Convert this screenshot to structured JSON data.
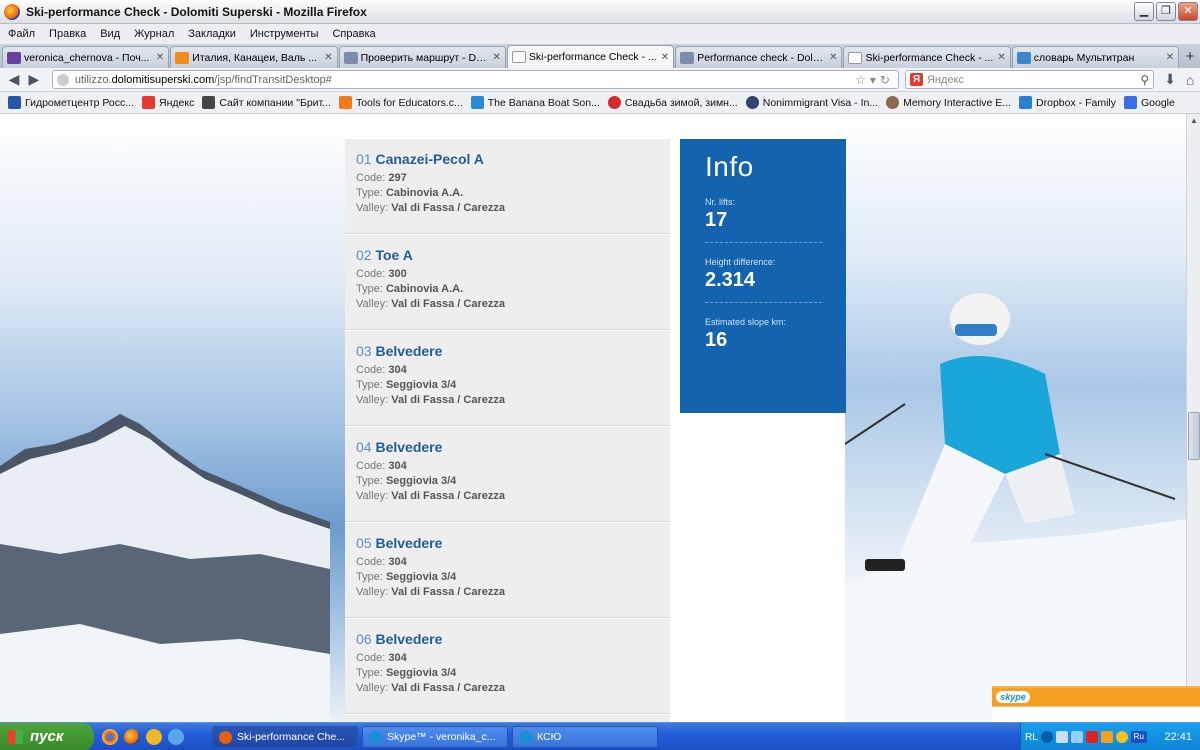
{
  "window": {
    "title": "Ski-performance Check - Dolomiti Superski - Mozilla Firefox"
  },
  "menu": [
    "Файл",
    "Правка",
    "Вид",
    "Журнал",
    "Закладки",
    "Инструменты",
    "Справка"
  ],
  "tabs": [
    {
      "label": "veronica_chernova - Поч...",
      "color": "#6b3fa0",
      "active": false
    },
    {
      "label": "Италия, Канацеи, Валь ...",
      "color": "#f08a1c",
      "active": false
    },
    {
      "label": "Проверить маршрут - Do...",
      "color": "#7a8ca8",
      "active": false
    },
    {
      "label": "Ski-performance Check - ...",
      "color": "#ffffff",
      "active": true
    },
    {
      "label": "Performance check - Dolo...",
      "color": "#7a8ca8",
      "active": false
    },
    {
      "label": "Ski-performance Check - ...",
      "color": "#ffffff",
      "active": false
    },
    {
      "label": "словарь Мультитран",
      "color": "#3a86c8",
      "active": false
    }
  ],
  "nav": {
    "url_prefix": "utilizzo.",
    "url_domain": "dolomitisuperski.com",
    "url_path": "/jsp/findTransitDesktop#",
    "search_placeholder": "Яндекс",
    "search_engine_glyph": "Я"
  },
  "bookmarks": [
    {
      "label": "Гидрометцентр Росс...",
      "color": "#2557a8"
    },
    {
      "label": "Яндекс",
      "color": "#e7382a"
    },
    {
      "label": "Сайт компании \"Брит...",
      "color": "#444444"
    },
    {
      "label": "Tools for Educators.c...",
      "color": "#f07a1a"
    },
    {
      "label": "The Banana Boat Son...",
      "color": "#2a8ad8"
    },
    {
      "label": "Свадьба зимой, зимн...",
      "color": "#d42a2a"
    },
    {
      "label": "Nonimmigrant Visa - In...",
      "color": "#33446a"
    },
    {
      "label": "Memory Interactive E...",
      "color": "#8a6a4a"
    },
    {
      "label": "Dropbox - Family",
      "color": "#2a7fd4"
    },
    {
      "label": "Google",
      "color": "#3a6ee8"
    }
  ],
  "lifts": [
    {
      "num": "01",
      "name": "Canazei-Pecol A",
      "code_label": "Code: ",
      "code": "297",
      "type_label": "Type: ",
      "type": "Cabinovia A.A.",
      "valley_label": "Valley: ",
      "valley": "Val di Fassa / Carezza"
    },
    {
      "num": "02",
      "name": "Toe A",
      "code_label": "Code: ",
      "code": "300",
      "type_label": "Type: ",
      "type": "Cabinovia A.A.",
      "valley_label": "Valley: ",
      "valley": "Val di Fassa / Carezza"
    },
    {
      "num": "03",
      "name": "Belvedere",
      "code_label": "Code: ",
      "code": "304",
      "type_label": "Type: ",
      "type": "Seggiovia 3/4",
      "valley_label": "Valley: ",
      "valley": "Val di Fassa / Carezza"
    },
    {
      "num": "04",
      "name": "Belvedere",
      "code_label": "Code: ",
      "code": "304",
      "type_label": "Type: ",
      "type": "Seggiovia 3/4",
      "valley_label": "Valley: ",
      "valley": "Val di Fassa / Carezza"
    },
    {
      "num": "05",
      "name": "Belvedere",
      "code_label": "Code: ",
      "code": "304",
      "type_label": "Type: ",
      "type": "Seggiovia 3/4",
      "valley_label": "Valley: ",
      "valley": "Val di Fassa / Carezza"
    },
    {
      "num": "06",
      "name": "Belvedere",
      "code_label": "Code: ",
      "code": "304",
      "type_label": "Type: ",
      "type": "Seggiovia 3/4",
      "valley_label": "Valley: ",
      "valley": "Val di Fassa / Carezza"
    }
  ],
  "info": {
    "title": "Info",
    "lifts_label": "Nr. lifts:",
    "lifts_value": "17",
    "height_label": "Height difference:",
    "height_value": "2.314",
    "slope_label": "Estimated slope km:",
    "slope_value": "16"
  },
  "skype_popup": {
    "badge": "skype"
  },
  "taskbar": {
    "start_label": "пуск",
    "buttons": [
      {
        "label": "Ski-performance Che...",
        "color": "#e8600c",
        "active": true
      },
      {
        "label": "Skype™ - veronika_c...",
        "color": "#1891d4",
        "active": false
      },
      {
        "label": "КСЮ",
        "color": "#1891d4",
        "active": false
      }
    ],
    "tray_lang": "RL",
    "tray_ru": "Ru",
    "clock": "22:41"
  }
}
